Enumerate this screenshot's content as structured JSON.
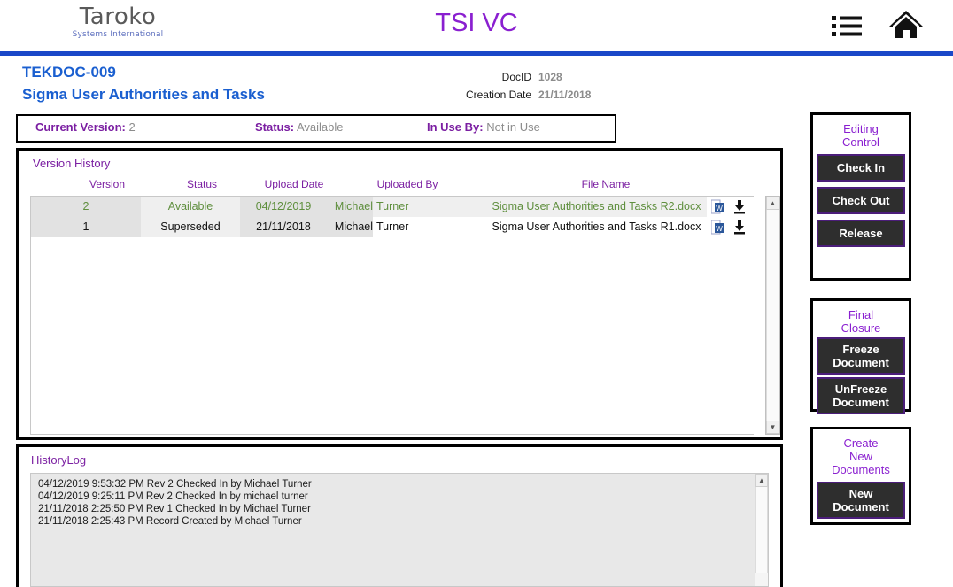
{
  "header": {
    "brand_name": "Taroko",
    "brand_sub": "Systems International",
    "app_title": "TSI VC",
    "list_icon": "list-icon",
    "home_icon": "home-icon"
  },
  "document": {
    "code": "TEKDOC-009",
    "title": "Sigma User Authorities and Tasks",
    "docid_label": "DocID",
    "docid_value": "1028",
    "creation_label": "Creation Date",
    "creation_value": "21/11/2018"
  },
  "status_strip": {
    "current_version_label": "Current Version:",
    "current_version_value": "2",
    "status_label": "Status:",
    "status_value": "Available",
    "in_use_by_label": "In Use By:",
    "in_use_by_value": "Not in Use"
  },
  "version_history": {
    "label": "Version History",
    "columns": [
      "Version",
      "Status",
      "Upload Date",
      "Uploaded By",
      "File Name"
    ],
    "rows": [
      {
        "version": "2",
        "status": "Available",
        "upload_date": "04/12/2019",
        "uploaded_by_first": "Michael",
        "uploaded_by_last": "Turner",
        "file_name": "Sigma User Authorities and Tasks R2.docx",
        "highlight": "green"
      },
      {
        "version": "1",
        "status": "Superseded",
        "upload_date": "21/11/2018",
        "uploaded_by_first": "Michael",
        "uploaded_by_last": "Turner",
        "file_name": "Sigma User Authorities and Tasks R1.docx",
        "highlight": "black"
      }
    ]
  },
  "history_log": {
    "label": "HistoryLog",
    "lines": [
      "04/12/2019 9:53:32 PM Rev 2 Checked In by Michael Turner",
      "04/12/2019 9:25:11 PM Rev 2 Checked In by michael turner",
      "21/11/2018 2:25:50 PM Rev 1 Checked In by Michael Turner",
      "21/11/2018 2:25:43 PM Record Created by Michael Turner"
    ]
  },
  "sidebar": {
    "editing_control": {
      "title": "Editing\nControl",
      "title_line1": "Editing",
      "title_line2": "Control",
      "buttons": [
        "Check In",
        "Check Out",
        "Release"
      ]
    },
    "final_closure": {
      "title_line1": "Final",
      "title_line2": "Closure",
      "buttons": [
        "Freeze\nDocument",
        "UnFreeze\nDocument"
      ],
      "button1_line1": "Freeze",
      "button1_line2": "Document",
      "button2_line1": "UnFreeze",
      "button2_line2": "Document"
    },
    "create_new": {
      "title_line1": "Create",
      "title_line2": "New",
      "title_line3": "Documents",
      "button_line1": "New",
      "button_line2": "Document"
    }
  },
  "colors": {
    "accent_purple": "#8a1fd0",
    "label_purple": "#7b1fa2",
    "title_blue": "#1a5fd0",
    "rule_blue": "#1a48c8",
    "row_green": "#5f8f3e",
    "button_dark": "#2e2e2e",
    "button_border": "#4b1d7a"
  }
}
